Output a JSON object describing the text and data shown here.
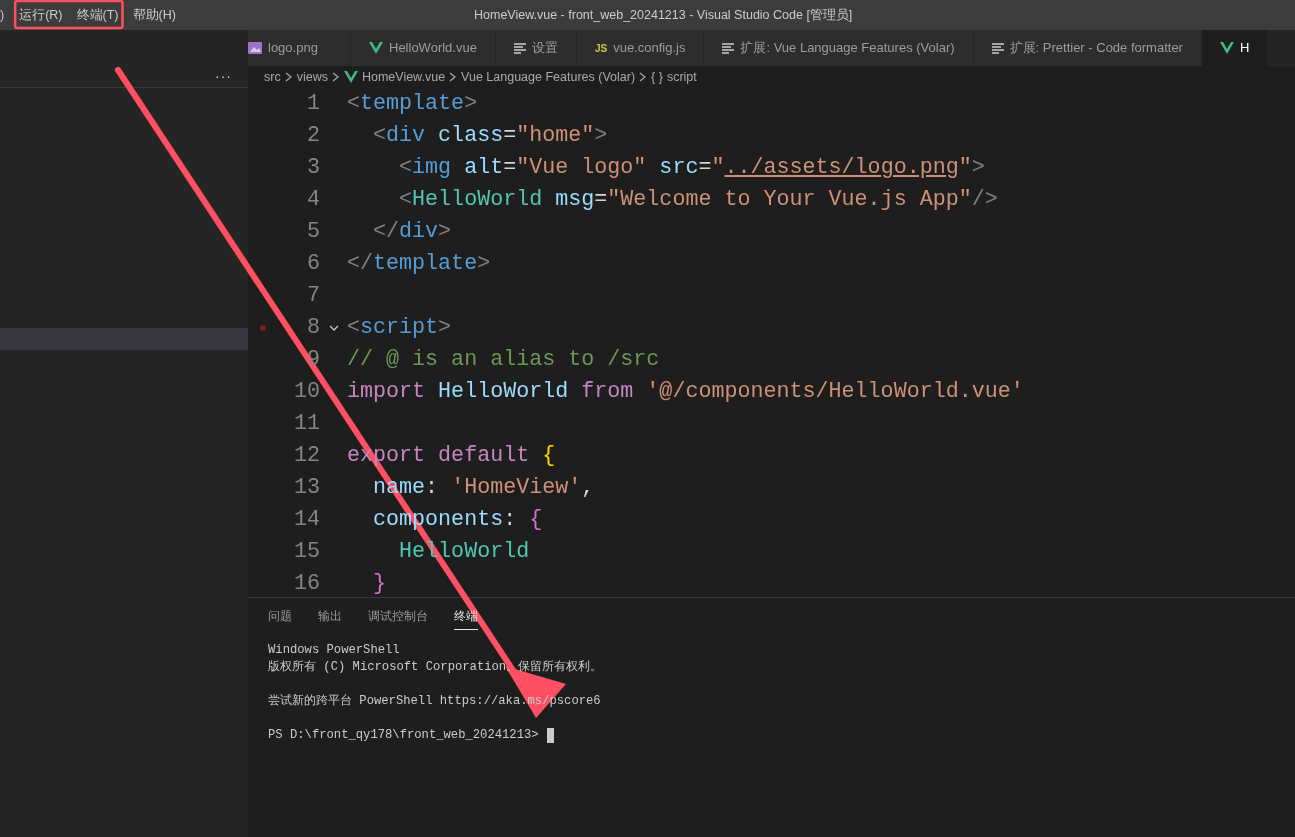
{
  "menu": [
    {
      "label": ")"
    },
    {
      "label": "运行(R)"
    },
    {
      "label": "终端(T)"
    },
    {
      "label": "帮助(H)"
    }
  ],
  "window": {
    "title": "HomeView.vue - front_web_20241213 - Visual Studio Code [管理员]"
  },
  "sidebar": {
    "more": "···"
  },
  "tabs": [
    {
      "label": "logo.png",
      "kind": "image",
      "selected": false
    },
    {
      "label": "HelloWorld.vue",
      "kind": "vue",
      "selected": false
    },
    {
      "label": "设置",
      "kind": "doc",
      "selected": false
    },
    {
      "label": "vue.config.js",
      "kind": "js",
      "icon_text": "JS",
      "selected": false
    },
    {
      "label": "扩展: Vue Language Features (Volar)",
      "kind": "doc",
      "selected": false
    },
    {
      "label": "扩展: Prettier - Code formatter",
      "kind": "doc",
      "selected": false
    },
    {
      "label": "H",
      "kind": "vue",
      "selected": true
    }
  ],
  "breadcrumb": [
    {
      "label": "src",
      "kind": "folder"
    },
    {
      "label": "views",
      "kind": "folder"
    },
    {
      "label": "HomeView.vue",
      "kind": "vue"
    },
    {
      "label": "Vue Language Features (Volar)",
      "kind": "folder"
    },
    {
      "label": "script",
      "kind": "braces",
      "icon_text": "{ }"
    }
  ],
  "code_lines": [
    {
      "number": "1",
      "breakpoint": false,
      "fold": false,
      "tokens": [
        {
          "t": "<",
          "kind": "punct"
        },
        {
          "t": "template",
          "kind": "tag"
        },
        {
          "t": ">",
          "kind": "punct"
        }
      ]
    },
    {
      "number": "2",
      "breakpoint": false,
      "fold": false,
      "tokens": [
        {
          "t": "  <",
          "kind": "punct"
        },
        {
          "t": "div",
          "kind": "tag"
        },
        {
          "t": " class",
          "kind": "attr"
        },
        {
          "t": "=",
          "kind": "text"
        },
        {
          "t": "\"home\"",
          "kind": "string"
        },
        {
          "t": ">",
          "kind": "punct"
        }
      ]
    },
    {
      "number": "3",
      "breakpoint": false,
      "fold": false,
      "tokens": [
        {
          "t": "    <",
          "kind": "punct"
        },
        {
          "t": "img",
          "kind": "tag"
        },
        {
          "t": " alt",
          "kind": "attr"
        },
        {
          "t": "=",
          "kind": "text"
        },
        {
          "t": "\"Vue logo\"",
          "kind": "string"
        },
        {
          "t": " src",
          "kind": "attr"
        },
        {
          "t": "=",
          "kind": "text"
        },
        {
          "t": "\"",
          "kind": "string"
        },
        {
          "t": "../assets/logo.png",
          "kind": "link"
        },
        {
          "t": "\"",
          "kind": "string"
        },
        {
          "t": ">",
          "kind": "punct"
        }
      ]
    },
    {
      "number": "4",
      "breakpoint": false,
      "fold": false,
      "tokens": [
        {
          "t": "    <",
          "kind": "punct"
        },
        {
          "t": "HelloWorld",
          "kind": "component"
        },
        {
          "t": " msg",
          "kind": "attr"
        },
        {
          "t": "=",
          "kind": "text"
        },
        {
          "t": "\"Welcome to Your Vue.js App\"",
          "kind": "string"
        },
        {
          "t": "/>",
          "kind": "punct"
        }
      ]
    },
    {
      "number": "5",
      "breakpoint": false,
      "fold": false,
      "tokens": [
        {
          "t": "  </",
          "kind": "punct"
        },
        {
          "t": "div",
          "kind": "tag"
        },
        {
          "t": ">",
          "kind": "punct"
        }
      ]
    },
    {
      "number": "6",
      "breakpoint": false,
      "fold": false,
      "tokens": [
        {
          "t": "</",
          "kind": "punct"
        },
        {
          "t": "template",
          "kind": "tag"
        },
        {
          "t": ">",
          "kind": "punct"
        }
      ]
    },
    {
      "number": "7",
      "breakpoint": false,
      "fold": false
    },
    {
      "number": "8",
      "breakpoint": true,
      "fold": true,
      "tokens": [
        {
          "t": "<",
          "kind": "punct"
        },
        {
          "t": "script",
          "kind": "tag"
        },
        {
          "t": ">",
          "kind": "punct"
        }
      ]
    },
    {
      "number": "9",
      "breakpoint": false,
      "fold": false,
      "tokens": [
        {
          "t": "// @ is an alias to /src",
          "kind": "comment"
        }
      ]
    },
    {
      "number": "10",
      "breakpoint": false,
      "fold": false,
      "tokens": [
        {
          "t": "import",
          "kind": "keyword"
        },
        {
          "t": " HelloWorld",
          "kind": "variable"
        },
        {
          "t": " from",
          "kind": "keyword"
        },
        {
          "t": " '@/components/HelloWorld.vue'",
          "kind": "string"
        }
      ]
    },
    {
      "number": "11",
      "breakpoint": false,
      "fold": false
    },
    {
      "number": "12",
      "breakpoint": false,
      "fold": false,
      "tokens": [
        {
          "t": "export default",
          "kind": "keyword"
        },
        {
          "t": " {",
          "kind": "brace1"
        }
      ]
    },
    {
      "number": "13",
      "breakpoint": false,
      "fold": false,
      "tokens": [
        {
          "t": "  name",
          "kind": "variable"
        },
        {
          "t": ": ",
          "kind": "text"
        },
        {
          "t": "'HomeView'",
          "kind": "string"
        },
        {
          "t": ",",
          "kind": "text"
        }
      ]
    },
    {
      "number": "14",
      "breakpoint": false,
      "fold": false,
      "tokens": [
        {
          "t": "  components",
          "kind": "variable"
        },
        {
          "t": ": ",
          "kind": "text"
        },
        {
          "t": "{",
          "kind": "brace2"
        }
      ]
    },
    {
      "number": "15",
      "breakpoint": false,
      "fold": false,
      "tokens": [
        {
          "t": "    HelloWorld",
          "kind": "component"
        }
      ]
    },
    {
      "number": "16",
      "breakpoint": false,
      "fold": false,
      "tokens": [
        {
          "t": "  }",
          "kind": "brace2"
        }
      ]
    }
  ],
  "panel": {
    "tabs": [
      {
        "label": "问题",
        "selected": false
      },
      {
        "label": "输出",
        "selected": false
      },
      {
        "label": "调试控制台",
        "selected": false
      },
      {
        "label": "终端",
        "selected": true
      }
    ],
    "terminal_lines": [
      {
        "text": "Windows PowerShell",
        "gap_before": false
      },
      {
        "text": "版权所有 (C) Microsoft Corporation。保留所有权利。",
        "gap_before": false
      },
      {
        "text": "尝试新的跨平台 PowerShell https://aka.ms/pscore6",
        "gap_before": true
      },
      {
        "text": "PS D:\\front_qy178\\front_web_20241213>",
        "gap_before": true
      }
    ]
  },
  "annotations": {
    "menu_highlight": true,
    "arrow": true
  }
}
